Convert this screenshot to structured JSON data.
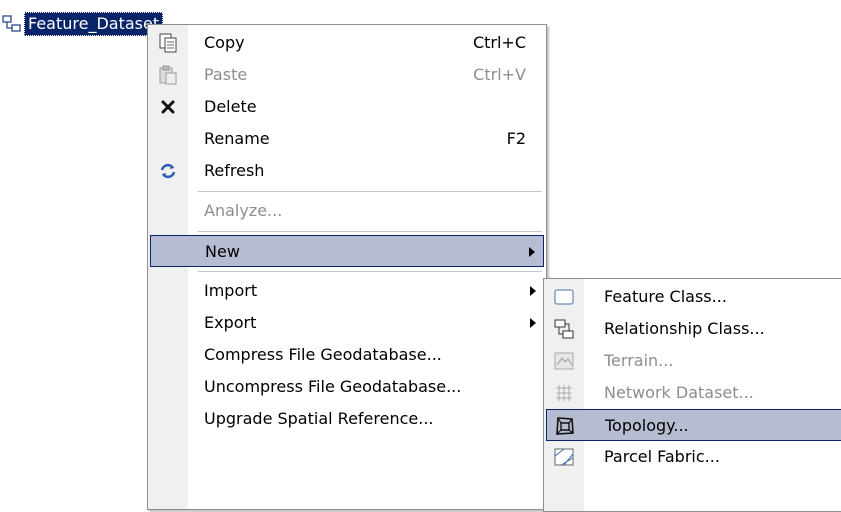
{
  "tree": {
    "node_label": "Feature_Dataset"
  },
  "context_menu": {
    "items": [
      {
        "label": "Copy",
        "shortcut": "Ctrl+C",
        "icon": "copy-icon",
        "enabled": true
      },
      {
        "label": "Paste",
        "shortcut": "Ctrl+V",
        "icon": "paste-icon",
        "enabled": false
      },
      {
        "label": "Delete",
        "shortcut": "",
        "icon": "delete-icon",
        "enabled": true
      },
      {
        "label": "Rename",
        "shortcut": "F2",
        "icon": "",
        "enabled": true
      },
      {
        "label": "Refresh",
        "shortcut": "",
        "icon": "refresh-icon",
        "enabled": true
      },
      {
        "label": "Analyze...",
        "shortcut": "",
        "icon": "",
        "enabled": false
      },
      {
        "label": "New",
        "shortcut": "",
        "icon": "",
        "enabled": true,
        "submenu": true,
        "highlighted": true
      },
      {
        "label": "Import",
        "shortcut": "",
        "icon": "",
        "enabled": true,
        "submenu": true
      },
      {
        "label": "Export",
        "shortcut": "",
        "icon": "",
        "enabled": true,
        "submenu": true
      },
      {
        "label": "Compress File Geodatabase...",
        "shortcut": "",
        "icon": "",
        "enabled": true
      },
      {
        "label": "Uncompress File Geodatabase...",
        "shortcut": "",
        "icon": "",
        "enabled": true
      },
      {
        "label": "Upgrade Spatial Reference...",
        "shortcut": "",
        "icon": "",
        "enabled": true
      }
    ]
  },
  "new_submenu": {
    "items": [
      {
        "label": "Feature Class...",
        "icon": "feature-class-icon",
        "enabled": true
      },
      {
        "label": "Relationship Class...",
        "icon": "relationship-class-icon",
        "enabled": true
      },
      {
        "label": "Terrain...",
        "icon": "terrain-icon",
        "enabled": false
      },
      {
        "label": "Network Dataset...",
        "icon": "network-dataset-icon",
        "enabled": false
      },
      {
        "label": "Topology...",
        "icon": "topology-icon",
        "enabled": true,
        "highlighted": true
      },
      {
        "label": "Parcel Fabric...",
        "icon": "parcel-fabric-icon",
        "enabled": true
      }
    ]
  },
  "colors": {
    "selection": "#0a246a",
    "highlight": "#b6bdd2",
    "gutter": "#f0f0f0",
    "disabled_text": "#8d8d8d"
  }
}
